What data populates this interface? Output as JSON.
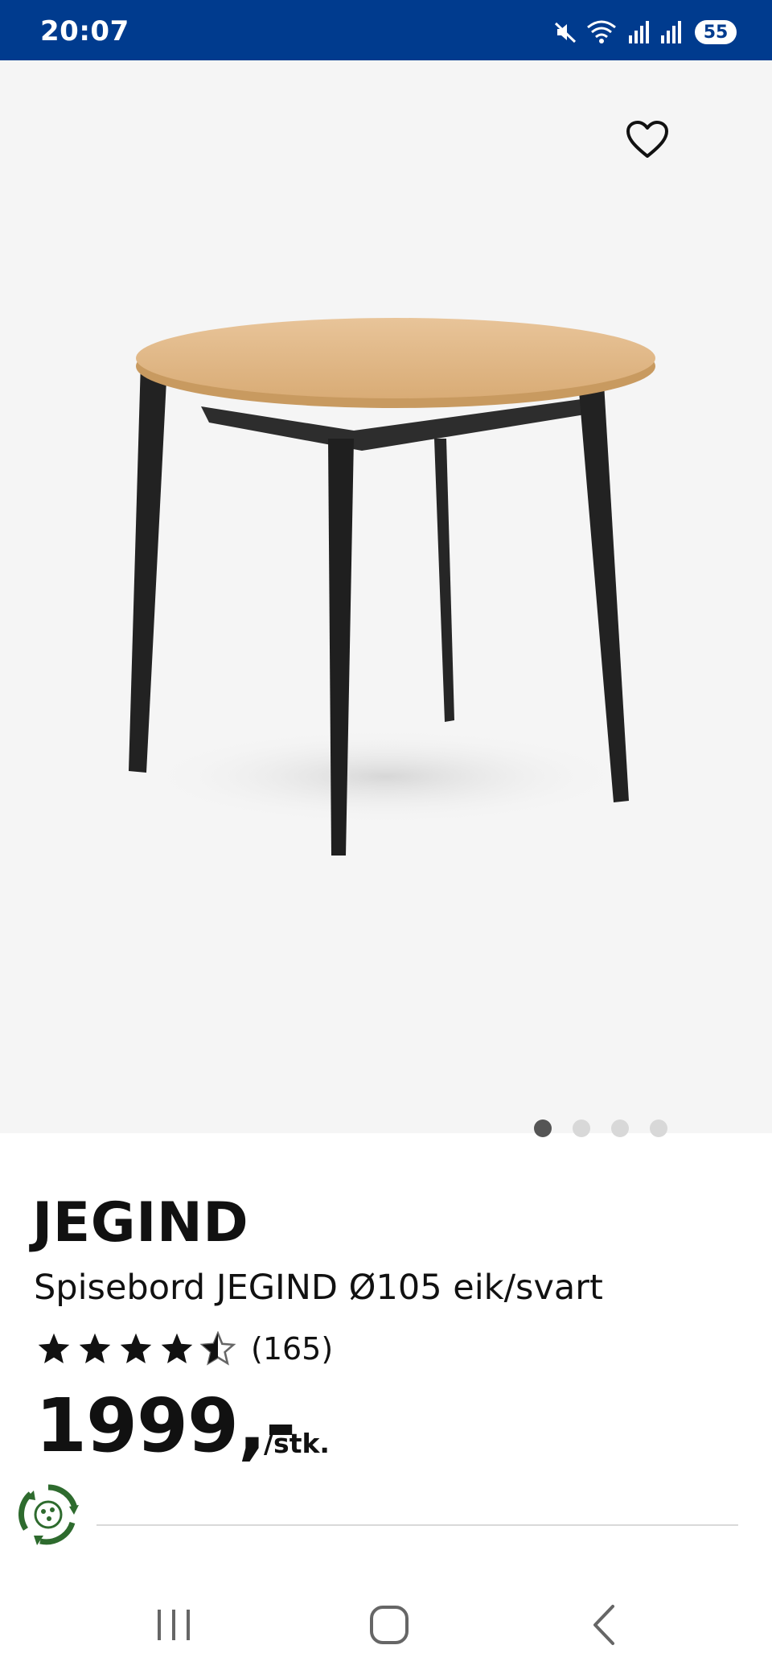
{
  "status_bar": {
    "time": "20:07",
    "battery": "55",
    "icons": [
      "mute-icon",
      "wifi-icon",
      "signal-icon",
      "signal-icon"
    ]
  },
  "gallery": {
    "image_count": 4,
    "active_index": 0
  },
  "product": {
    "brand": "JEGIND",
    "description": "Spisebord JEGIND Ø105 eik/svart",
    "rating": 4.5,
    "review_count": "(165)",
    "price": "1999,-",
    "unit": "/stk."
  },
  "colors": {
    "status_bar": "#003b8e",
    "gallery_bg": "#f5f5f5",
    "eco_green": "#2e6b2e",
    "text": "#111111"
  }
}
